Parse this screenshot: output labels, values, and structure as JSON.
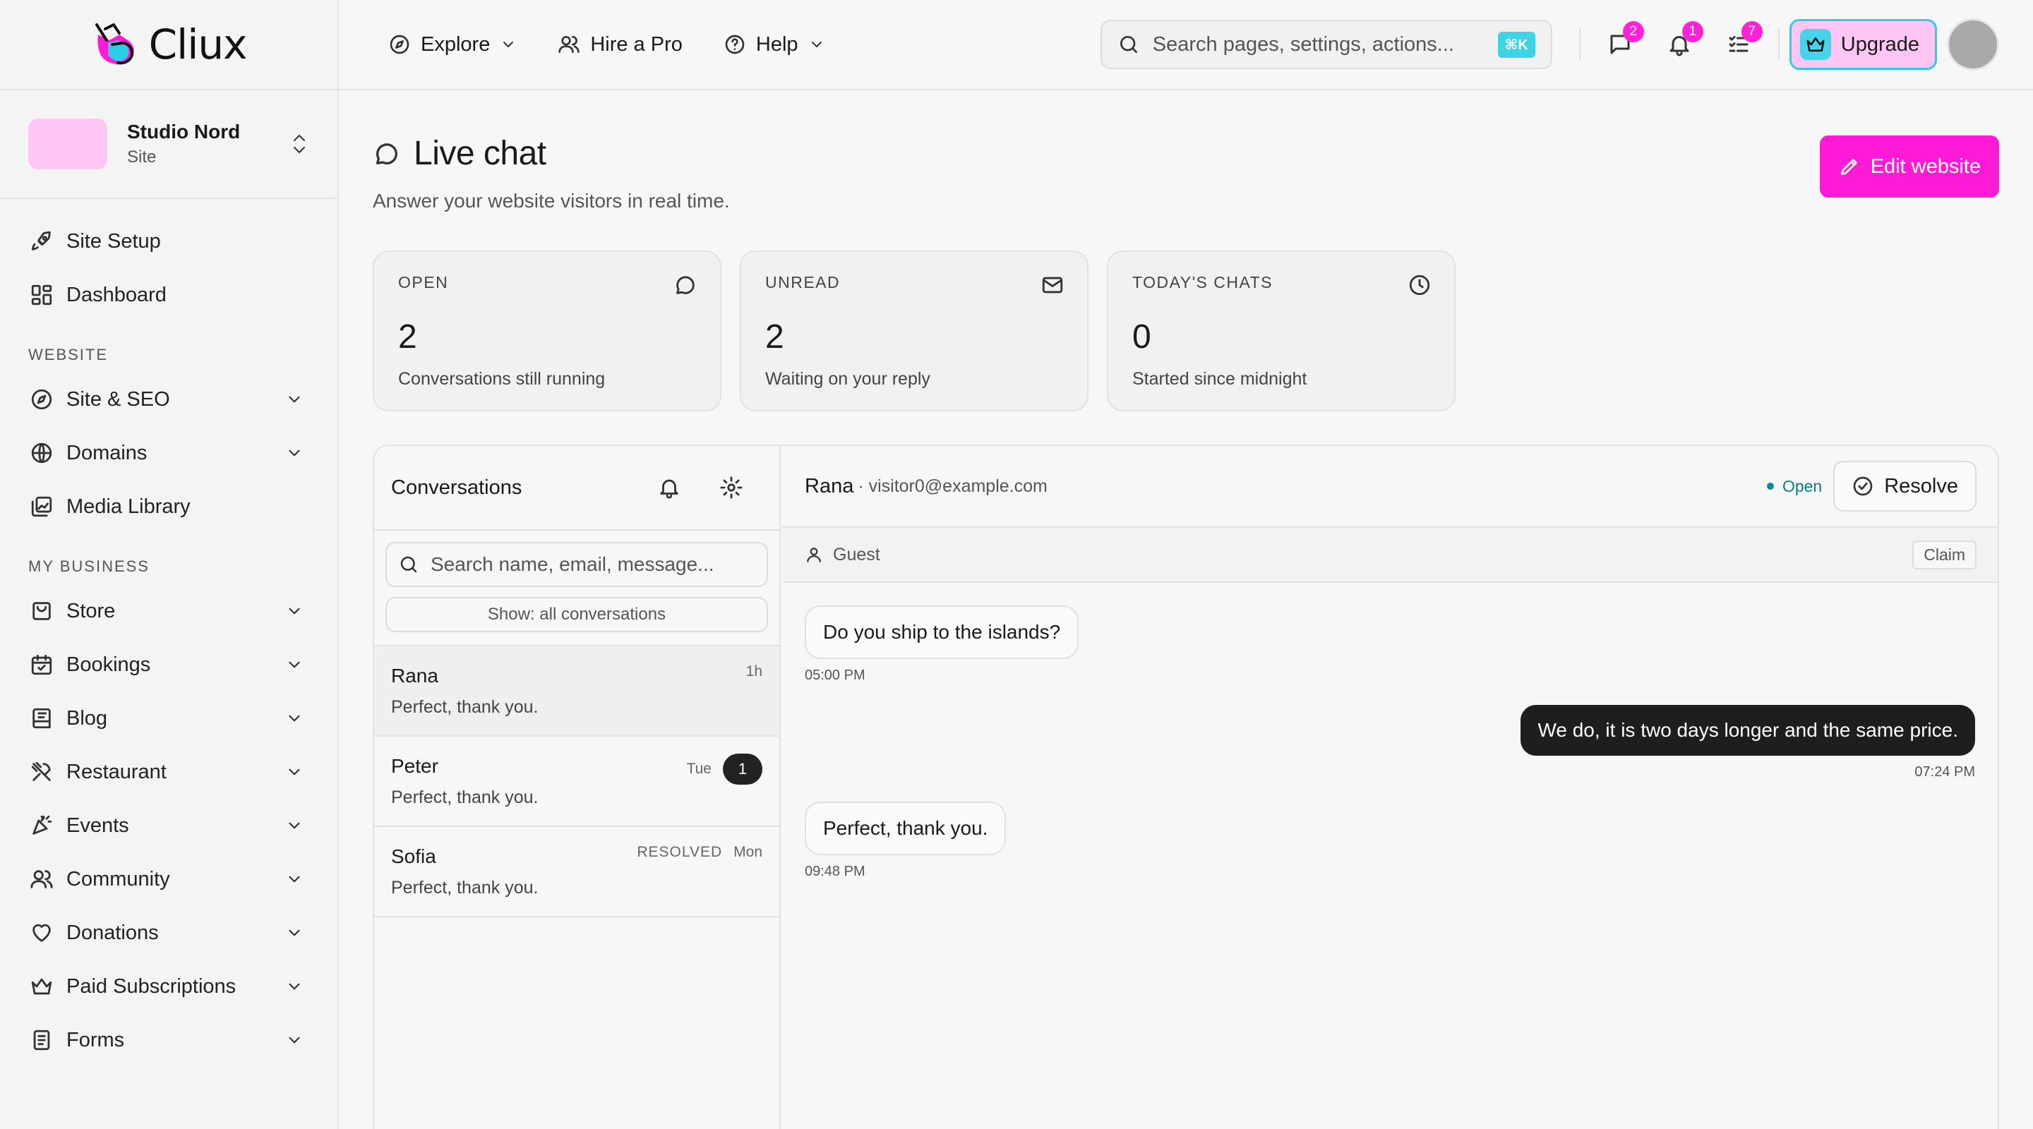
{
  "brand": {
    "name": "Cliux"
  },
  "site": {
    "name": "Studio Nord",
    "type": "Site"
  },
  "sidebar": {
    "top_items": [
      {
        "label": "Site Setup",
        "icon": "rocket-icon"
      },
      {
        "label": "Dashboard",
        "icon": "dashboard-icon"
      }
    ],
    "sections": [
      {
        "title": "WEBSITE",
        "items": [
          {
            "label": "Site & SEO",
            "icon": "compass-icon"
          },
          {
            "label": "Domains",
            "icon": "globe-icon"
          },
          {
            "label": "Media Library",
            "icon": "media-icon"
          }
        ]
      },
      {
        "title": "MY BUSINESS",
        "items": [
          {
            "label": "Store",
            "icon": "store-icon"
          },
          {
            "label": "Bookings",
            "icon": "calendar-icon"
          },
          {
            "label": "Blog",
            "icon": "book-icon"
          },
          {
            "label": "Restaurant",
            "icon": "utensils-icon"
          },
          {
            "label": "Events",
            "icon": "party-icon"
          },
          {
            "label": "Community",
            "icon": "users-icon"
          },
          {
            "label": "Donations",
            "icon": "heart-icon"
          },
          {
            "label": "Paid Subscriptions",
            "icon": "crown-icon"
          },
          {
            "label": "Forms",
            "icon": "form-icon"
          }
        ]
      }
    ]
  },
  "topbar": {
    "explore": "Explore",
    "hire": "Hire a Pro",
    "help": "Help",
    "search_placeholder": "Search pages, settings, actions...",
    "shortcut": "⌘K",
    "badges": {
      "messages": "2",
      "notifications": "1",
      "tasks": "7"
    },
    "upgrade": "Upgrade"
  },
  "page": {
    "title": "Live chat",
    "subtitle": "Answer your website visitors in real time.",
    "edit_button": "Edit website"
  },
  "stats": [
    {
      "label": "OPEN",
      "value": "2",
      "desc": "Conversations still running",
      "icon": "chat-bubble-icon"
    },
    {
      "label": "UNREAD",
      "value": "2",
      "desc": "Waiting on your reply",
      "icon": "mail-icon"
    },
    {
      "label": "TODAY'S CHATS",
      "value": "0",
      "desc": "Started since midnight",
      "icon": "clock-icon"
    }
  ],
  "conversations": {
    "title": "Conversations",
    "search_placeholder": "Search name, email, message...",
    "filter": "Show: all conversations",
    "items": [
      {
        "name": "Rana",
        "preview": "Perfect, thank you.",
        "time": "1h",
        "status": "",
        "unread": ""
      },
      {
        "name": "Peter",
        "preview": "Perfect, thank you.",
        "time": "Tue",
        "status": "",
        "unread": "1"
      },
      {
        "name": "Sofia",
        "preview": "Perfect, thank you.",
        "time": "Mon",
        "status": "RESOLVED",
        "unread": ""
      }
    ]
  },
  "chat": {
    "name": "Rana",
    "email": "· visitor0@example.com",
    "status": "Open",
    "resolve": "Resolve",
    "guest": "Guest",
    "claim": "Claim",
    "messages": [
      {
        "direction": "in",
        "text": "Do you ship to the islands?",
        "time": "05:00 PM"
      },
      {
        "direction": "out",
        "text": "We do, it is two days longer and the same price.",
        "time": "07:24 PM"
      },
      {
        "direction": "in",
        "text": "Perfect, thank you.",
        "time": "09:48 PM"
      }
    ]
  },
  "colors": {
    "accent": "#ff1ad8",
    "badge": "#ff22d6",
    "cyan": "#2ccde6",
    "open": "#0a7c86"
  }
}
